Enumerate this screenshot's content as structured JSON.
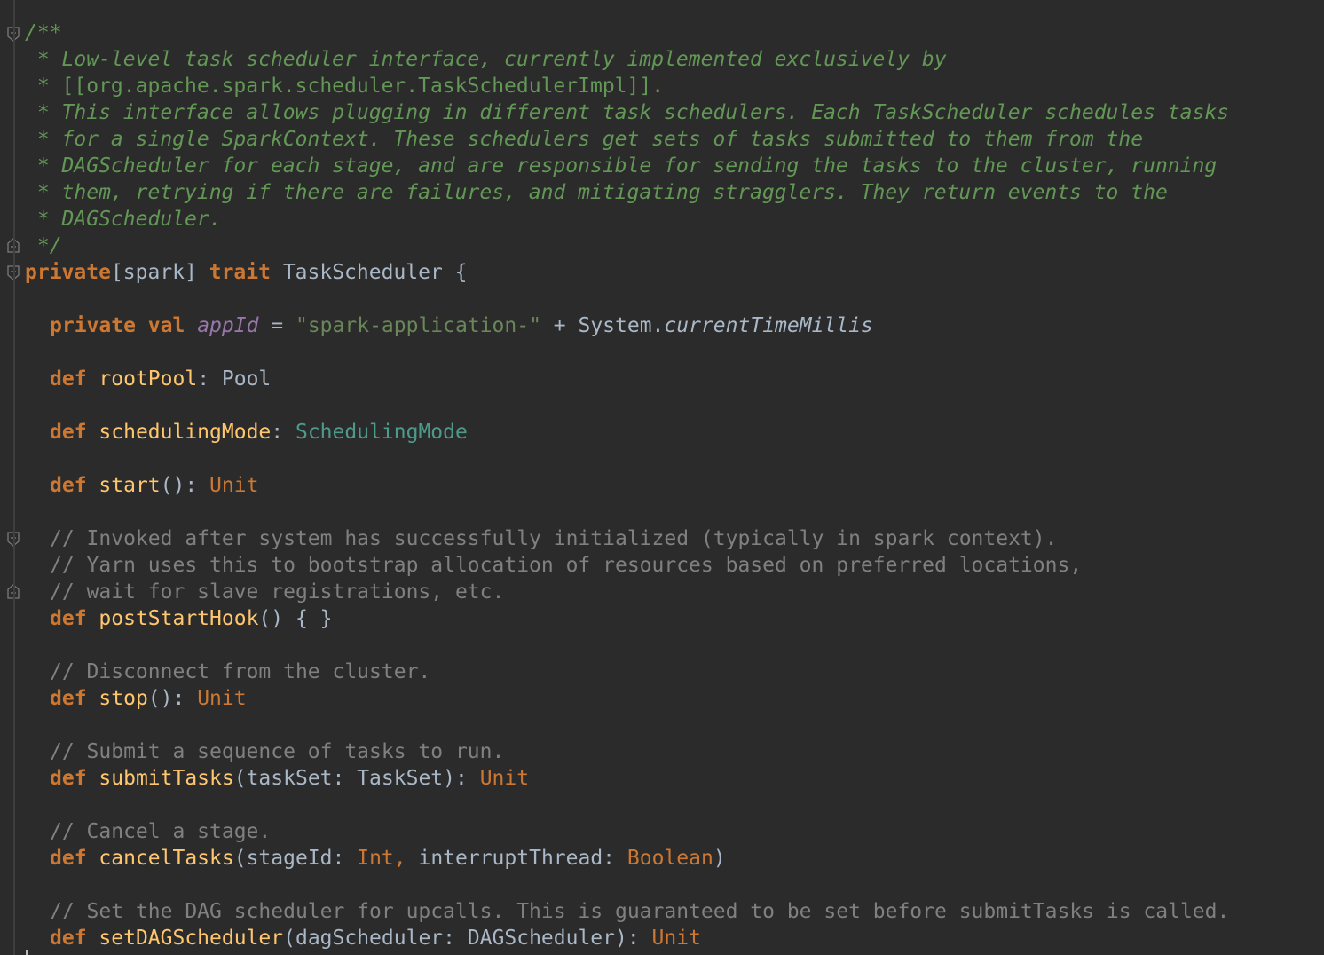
{
  "doc_comment": [
    "/**",
    " * Low-level task scheduler interface, currently implemented exclusively by",
    " * [[org.apache.spark.scheduler.TaskSchedulerImpl]].",
    " * This interface allows plugging in different task schedulers. Each TaskScheduler schedules tasks",
    " * for a single SparkContext. These schedulers get sets of tasks submitted to them from the",
    " * DAGScheduler for each stage, and are responsible for sending the tasks to the cluster, running",
    " * them, retrying if there are failures, and mitigating stragglers. They return events to the",
    " * DAGScheduler.",
    " */"
  ],
  "doc_ref_prefix": " * ",
  "doc_ref": "[[org.apache.spark.scheduler.TaskSchedulerImpl]].",
  "trait_decl": {
    "kw_private": "private",
    "scope": "[spark] ",
    "kw_trait": "trait",
    "name": " TaskScheduler {"
  },
  "app_id": {
    "kw": "private val",
    "name": "appId",
    "eq": " = ",
    "str": "\"spark-application-\"",
    "plus": " + System.",
    "call": "currentTimeMillis"
  },
  "root_pool": {
    "kw": "def",
    "name": "rootPool",
    "sep": ": ",
    "type": "Pool"
  },
  "scheduling_mode": {
    "kw": "def",
    "name": "schedulingMode",
    "sep": ": ",
    "type": "SchedulingMode"
  },
  "start": {
    "kw": "def",
    "name": "start",
    "sep": "(): ",
    "type": "Unit"
  },
  "post_start_comments": [
    "// Invoked after system has successfully initialized (typically in spark context).",
    "// Yarn uses this to bootstrap allocation of resources based on preferred locations,",
    "// wait for slave registrations, etc."
  ],
  "post_start_hook": {
    "kw": "def",
    "name": "postStartHook",
    "rest": "() { }"
  },
  "stop_comment": "// Disconnect from the cluster.",
  "stop": {
    "kw": "def",
    "name": "stop",
    "sep": "(): ",
    "type": "Unit"
  },
  "submit_comment": "// Submit a sequence of tasks to run.",
  "submit_tasks": {
    "kw": "def",
    "name": "submitTasks",
    "params": "(taskSet: TaskSet): ",
    "type": "Unit"
  },
  "cancel_comment": "// Cancel a stage.",
  "cancel_tasks": {
    "kw": "def",
    "name": "cancelTasks",
    "p1": "(stageId: ",
    "t1": "Int, ",
    "p2": "interruptThread: ",
    "t2": "Boolean",
    "close": ")"
  },
  "set_dag_comment": "// Set the DAG scheduler for upcalls. This is guaranteed to be set before submitTasks is called.",
  "set_dag_scheduler": {
    "kw": "def",
    "name": "setDAGScheduler",
    "params": "(dagScheduler: DAGScheduler): ",
    "type": "Unit"
  },
  "icons": {
    "fold_open": "fold-open-icon",
    "fold_close": "fold-close-icon"
  },
  "colors": {
    "background": "#2b2b2b",
    "doc_comment": "#629755",
    "line_comment": "#808080",
    "keyword": "#cc7832",
    "string": "#6a8759",
    "field": "#9876aa",
    "function": "#ffc66d",
    "plain": "#a9b7c6",
    "type_teal": "#4e9a8a"
  }
}
